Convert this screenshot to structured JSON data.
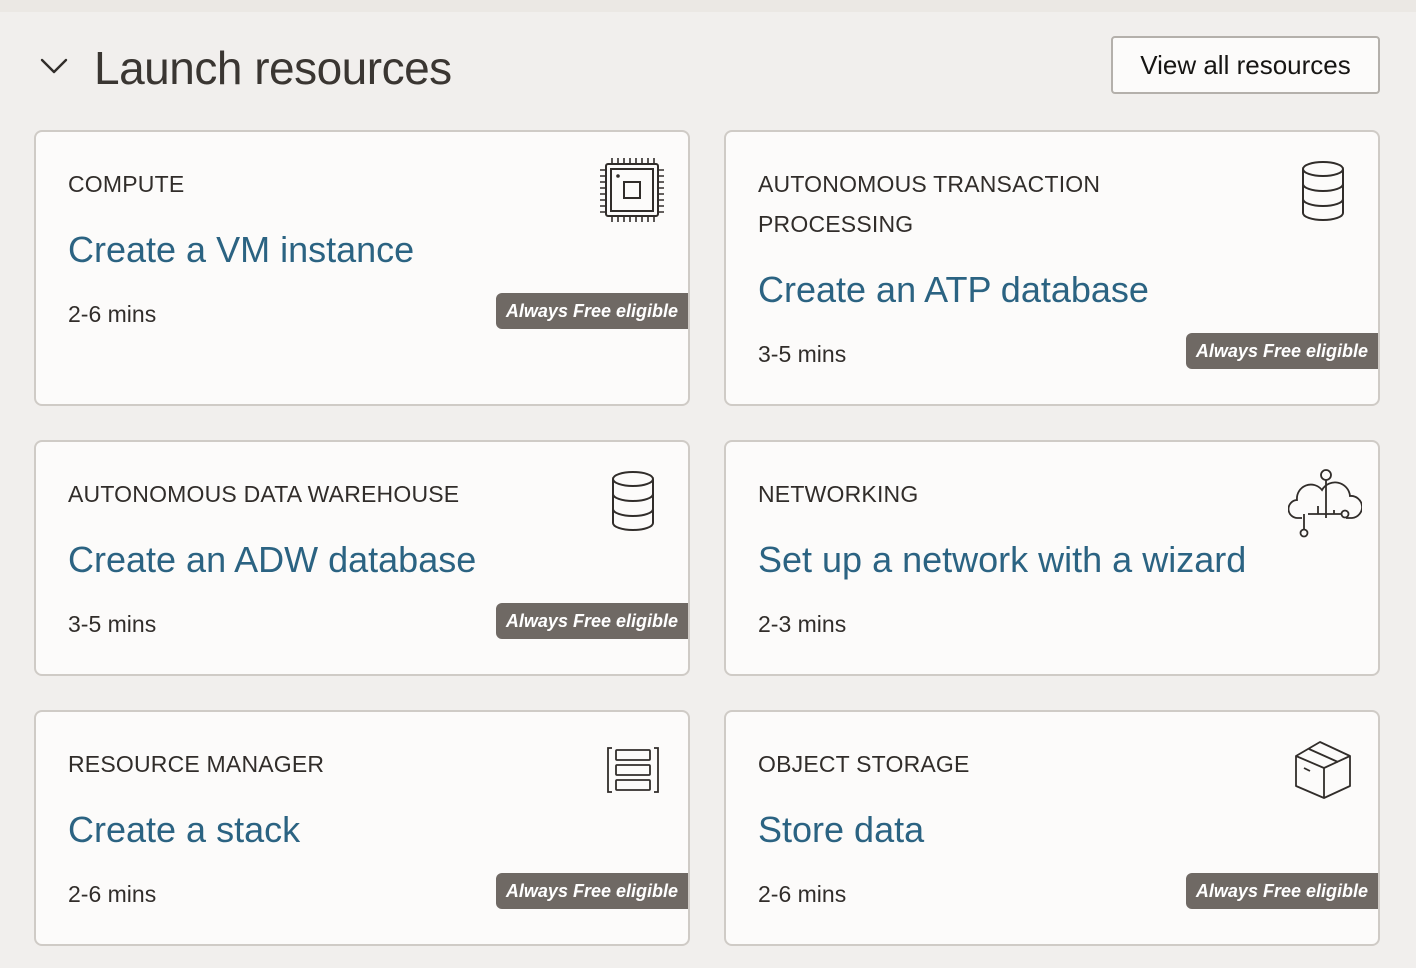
{
  "header": {
    "title": "Launch resources",
    "view_all_label": "View all resources",
    "toggle_icon": "chevron-down-icon"
  },
  "badge_label": "Always Free eligible",
  "colors": {
    "background": "#f1efed",
    "card_background": "#fcfbfa",
    "link": "#2b6382",
    "badge": "#6f6964",
    "text": "#312d2a"
  },
  "cards": [
    {
      "category": "COMPUTE",
      "action": "Create a VM instance",
      "duration": "2-6 mins",
      "icon": "cpu-chip-icon",
      "always_free": true
    },
    {
      "category": "AUTONOMOUS TRANSACTION PROCESSING",
      "action": "Create an ATP database",
      "duration": "3-5 mins",
      "icon": "database-icon",
      "always_free": true
    },
    {
      "category": "AUTONOMOUS DATA WAREHOUSE",
      "action": "Create an ADW database",
      "duration": "3-5 mins",
      "icon": "database-icon",
      "always_free": true
    },
    {
      "category": "NETWORKING",
      "action": "Set up a network with a wizard",
      "duration": "2-3 mins",
      "icon": "cloud-network-icon",
      "always_free": false
    },
    {
      "category": "RESOURCE MANAGER",
      "action": "Create a stack",
      "duration": "2-6 mins",
      "icon": "stack-icon",
      "always_free": true
    },
    {
      "category": "OBJECT STORAGE",
      "action": "Store data",
      "duration": "2-6 mins",
      "icon": "storage-box-icon",
      "always_free": true
    }
  ]
}
